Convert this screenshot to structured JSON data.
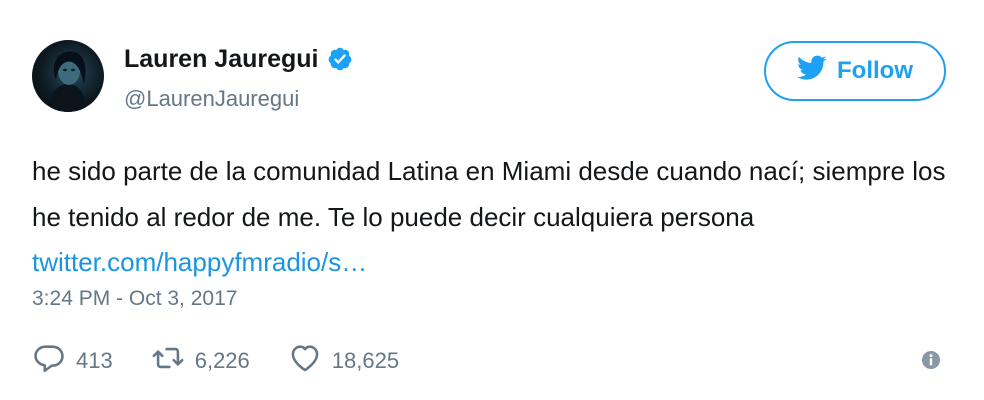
{
  "tweet": {
    "author": {
      "display_name": "Lauren Jauregui",
      "handle": "@LaurenJauregui",
      "verified": true
    },
    "follow_label": "Follow",
    "text": "he sido parte de la comunidad Latina en Miami desde cuando nací; siempre los he tenido al redor de me. Te lo puede decir cualquiera persona ",
    "link_text": "twitter.com/happyfmradio/s…",
    "timestamp": "3:24 PM - Oct 3, 2017",
    "stats": {
      "replies": "413",
      "retweets": "6,226",
      "likes": "18,625"
    }
  },
  "icons": {
    "verified": "verified-badge-icon",
    "follow": "twitter-bird-icon",
    "reply": "reply-icon",
    "retweet": "retweet-icon",
    "like": "heart-icon",
    "info": "info-icon"
  },
  "colors": {
    "brand_blue": "#1da1f2",
    "link_blue": "#1b95e0",
    "muted_gray": "#657786",
    "text": "#14171a"
  }
}
